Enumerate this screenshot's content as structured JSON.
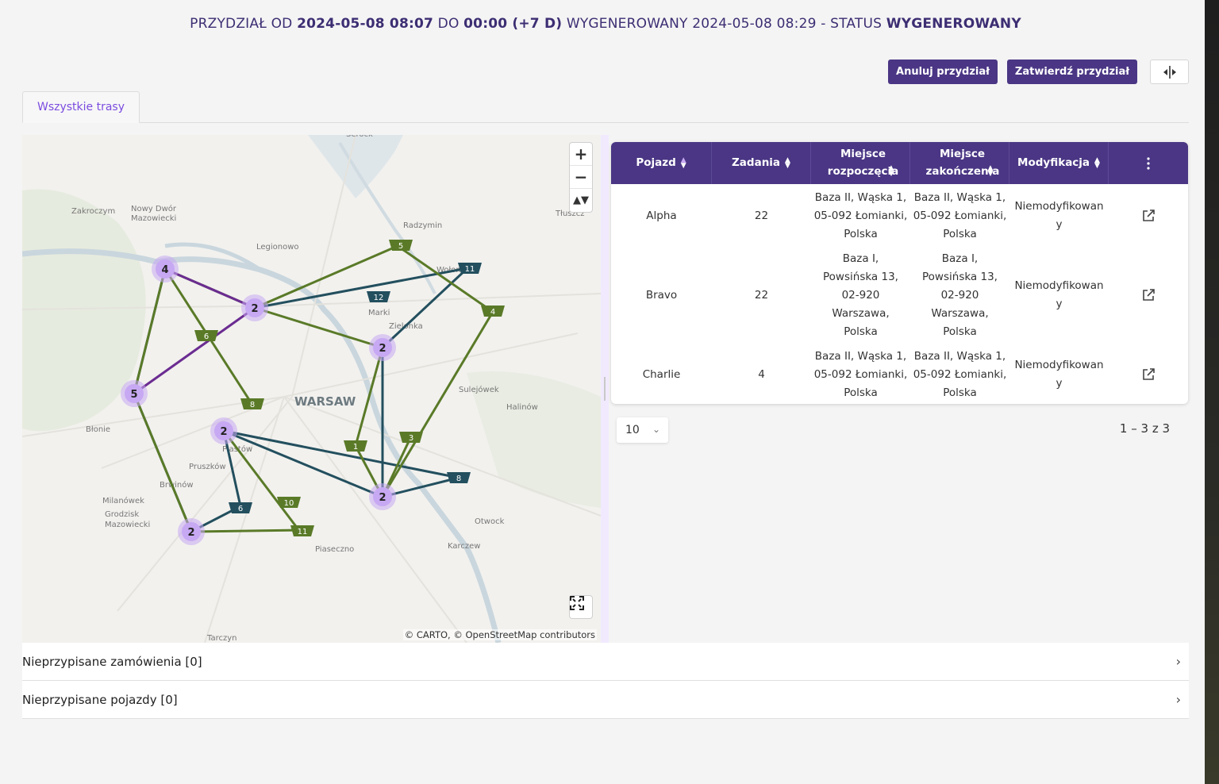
{
  "header": {
    "prefix": "PRZYDZIAŁ OD",
    "date_from": "2024-05-08 08:07",
    "to_label": "DO",
    "date_to": "00:00 (+7 D)",
    "generated_label": "WYGENEROWANY 2024-05-08 08:29 - STATUS",
    "status": "WYGENEROWANY"
  },
  "toolbar": {
    "cancel_label": "Anuluj przydział",
    "confirm_label": "Zatwierdź przydział",
    "split_icon": "split-view-icon"
  },
  "tabs": [
    {
      "label": "Wszystkie trasy"
    }
  ],
  "map": {
    "attribution": "© CARTO, © OpenStreetMap contributors",
    "zoom_in": "+",
    "zoom_out": "−",
    "compass": "▲▼",
    "colors": {
      "green": "#5a7a28",
      "teal": "#234f5e",
      "purple": "#6b2c91",
      "cluster": "#c7a8f3"
    },
    "towns": [
      "Zakroczym",
      "Nowy Dwór",
      "Mazowiecki",
      "Legionowo",
      "Radzymin",
      "Tłuszcz",
      "Wołomin",
      "Marki",
      "Zielonka",
      "WARSAW",
      "Sulejówek",
      "Halinów",
      "Błonie",
      "Piastów",
      "Pruszków",
      "Brwinów",
      "Milanówek",
      "Grodzisk",
      "Mazowiecki",
      "Otwock",
      "Karczew",
      "Piaseczno",
      "Tarczyn",
      "Serock"
    ],
    "clusters": [
      "4",
      "2",
      "5",
      "2",
      "2",
      "2",
      "2"
    ],
    "markers": [
      "5",
      "11",
      "12",
      "4",
      "6",
      "8",
      "1",
      "3",
      "8",
      "10",
      "6",
      "11"
    ]
  },
  "table": {
    "columns": [
      "Pojazd",
      "Zadania",
      "Miejsce rozpoczęcia",
      "Miejsce zakończenia",
      "Modyfikacja"
    ],
    "menu_icon": "more-vert-icon",
    "rows": [
      {
        "vehicle": "Alpha",
        "tasks": "22",
        "start": "Baza II, Wąska 1, 05-092 Łomianki, Polska",
        "end": "Baza II, Wąska 1, 05-092 Łomianki, Polska",
        "modification": "Niemodyfikowany"
      },
      {
        "vehicle": "Bravo",
        "tasks": "22",
        "start": "Baza I, Powsińska 13, 02-920 Warszawa, Polska",
        "end": "Baza I, Powsińska 13, 02-920 Warszawa, Polska",
        "modification": "Niemodyfikowany"
      },
      {
        "vehicle": "Charlie",
        "tasks": "4",
        "start": "Baza II, Wąska 1, 05-092 Łomianki, Polska",
        "end": "Baza II, Wąska 1, 05-092 Łomianki, Polska",
        "modification": "Niemodyfikowany"
      }
    ]
  },
  "pagination": {
    "page_size": "10",
    "range": "1 – 3 z 3"
  },
  "panels": [
    {
      "label": "Nieprzypisane zamówienia [0]"
    },
    {
      "label": "Nieprzypisane pojazdy [0]"
    }
  ]
}
